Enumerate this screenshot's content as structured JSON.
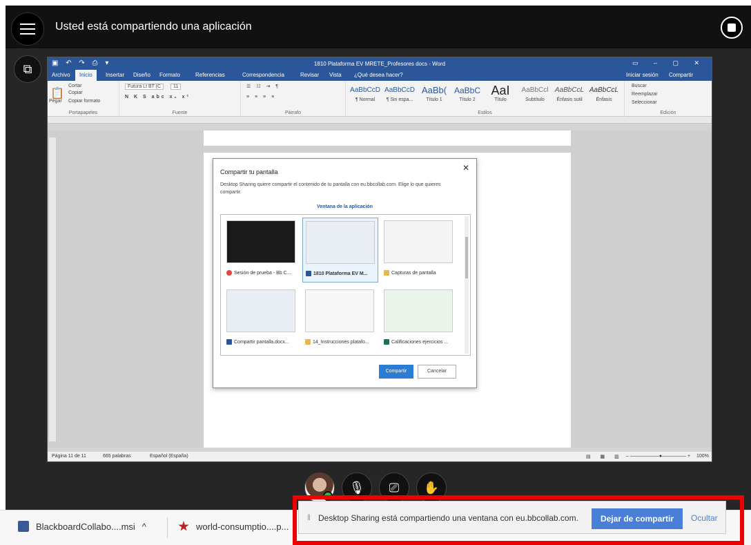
{
  "collab": {
    "share_title": "Usted está compartiendo una aplicación"
  },
  "word": {
    "doc_title": "1810 Plataforma EV MRETE_Profesores docs - Word",
    "tabs": [
      "Archivo",
      "Inicio",
      "Insertar",
      "Diseño",
      "Formato",
      "Referencias",
      "Correspondencia",
      "Revisar",
      "Vista",
      "¿Qué desea hacer?"
    ],
    "signin": "Iniciar sesión",
    "share": "Compartir",
    "clipboard": {
      "cut": "Cortar",
      "copy": "Copiar",
      "paste": "Pegar",
      "format": "Copiar formato",
      "label": "Portapapeles"
    },
    "font_label": "Fuente",
    "font_name": "Futura Lt BT (C",
    "font_size": "11",
    "paragraph_label": "Párrafo",
    "styles_label": "Estilos",
    "editing_label": "Edición",
    "styles": [
      {
        "sample": "AaBbCcD",
        "name": "¶ Normal"
      },
      {
        "sample": "AaBbCcD",
        "name": "¶ Sin espa..."
      },
      {
        "sample": "AaBb(",
        "name": "Título 1"
      },
      {
        "sample": "AaBbC",
        "name": "Título 2"
      },
      {
        "sample": "AaI",
        "name": "Título"
      },
      {
        "sample": "AaBbCcl",
        "name": "Subtítulo"
      },
      {
        "sample": "AaBbCcL",
        "name": "Énfasis sutil"
      },
      {
        "sample": "AaBbCcL",
        "name": "Énfasis"
      }
    ],
    "editing": {
      "find": "Buscar",
      "replace": "Reemplazar",
      "select": "Seleccionar"
    },
    "status": {
      "page": "Página 11 de 11",
      "words": "665 palabras",
      "lang": "Español (España)",
      "zoom": "100%"
    }
  },
  "dialog": {
    "title": "Compartir tu pantalla",
    "description": "Desktop Sharing quiere compartir el contenido de tu pantalla con eu.bbcollab.com. Elige lo que quieres compartir.",
    "tab": "Ventana de la aplicación",
    "windows": [
      {
        "label": "Sesión de prueba - Bb C...",
        "icon_color": "#e04a3a"
      },
      {
        "label": "1810 Plataforma EV M...",
        "icon_color": "#2b579a"
      },
      {
        "label": "Capturas de pantalla",
        "icon_color": "#e8b84a"
      },
      {
        "label": "Compartir pantalla.docx...",
        "icon_color": "#2b579a"
      },
      {
        "label": "14_Instrucciones platafo...",
        "icon_color": "#e8b84a"
      },
      {
        "label": "Calificaciones ejercicios ...",
        "icon_color": "#217346"
      }
    ],
    "share_button": "Compartir",
    "cancel_button": "Cancelar"
  },
  "downloads": [
    {
      "name": "BlackboardCollabo....msi"
    },
    {
      "name": "world-consumptio....p..."
    }
  ],
  "notice": {
    "message": "Desktop Sharing está compartiendo una ventana con eu.bbcollab.com.",
    "stop": "Dejar de compartir",
    "hide": "Ocultar"
  },
  "colors": {
    "word_blue": "#2b579a",
    "highlight": "#e00000",
    "stop_button": "#4a7fd8"
  }
}
